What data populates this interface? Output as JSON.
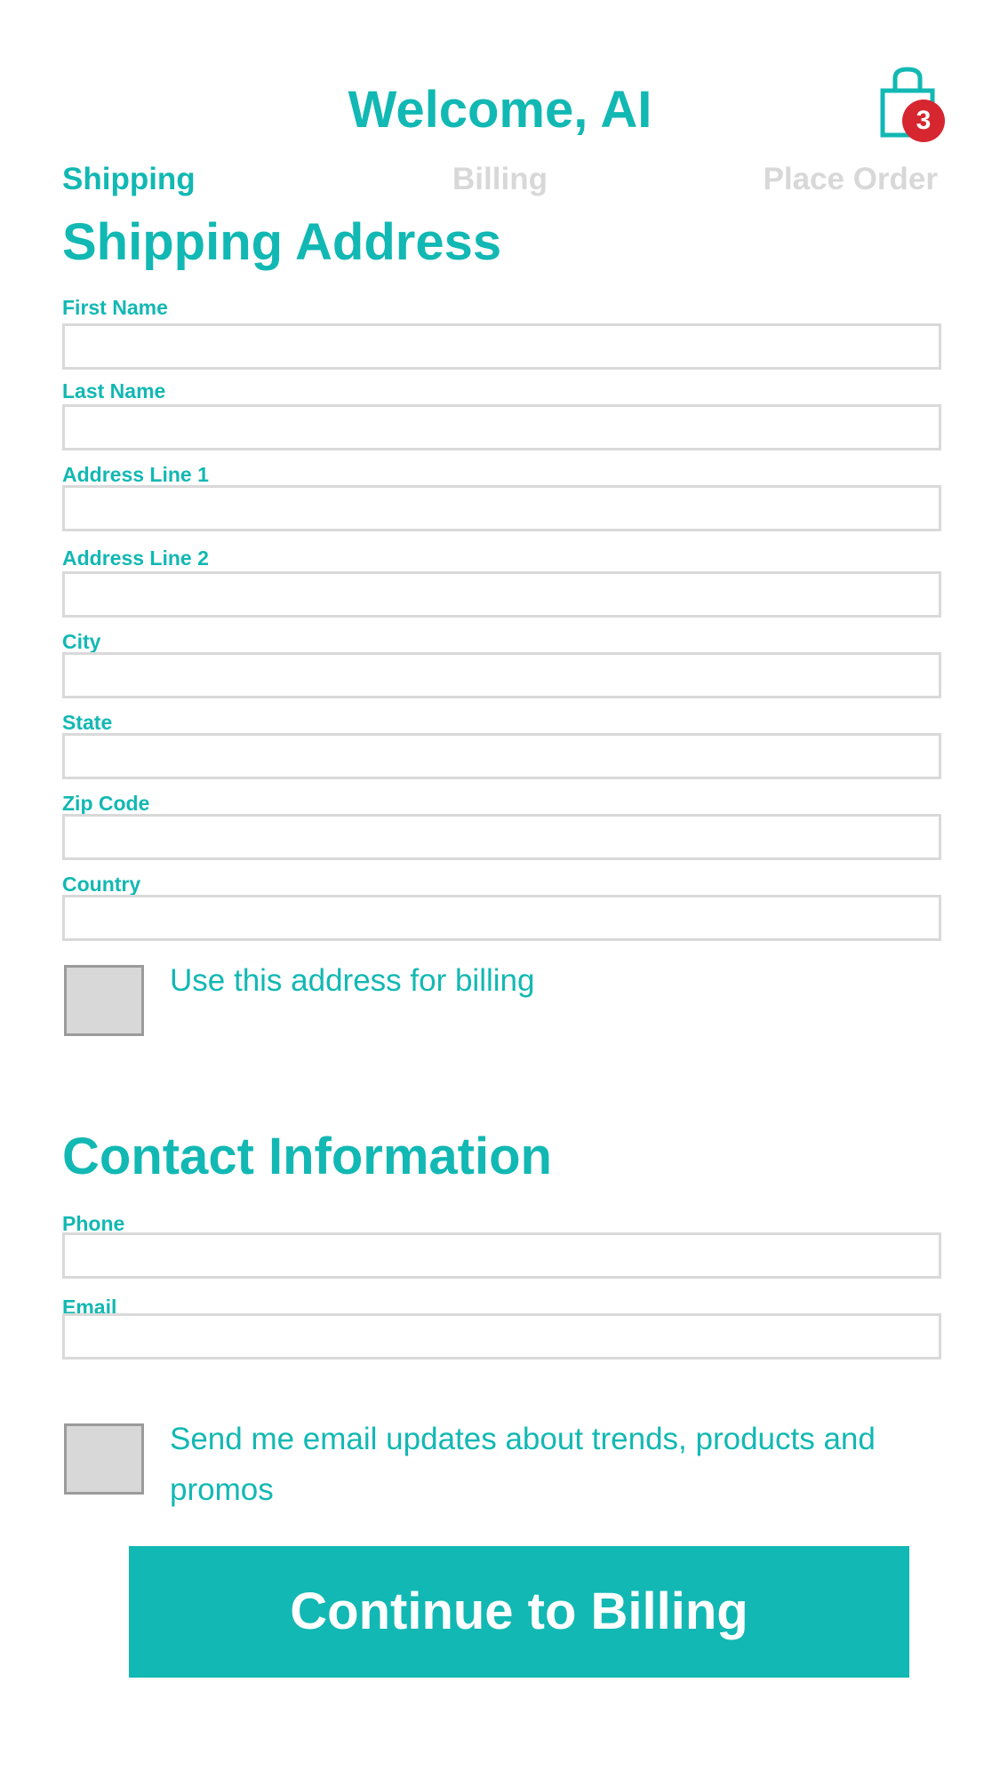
{
  "header": {
    "title": "Welcome, AI",
    "cart_count": "3"
  },
  "steps": [
    {
      "label": "Shipping",
      "state": "active"
    },
    {
      "label": "Billing",
      "state": "inactive"
    },
    {
      "label": "Place Order",
      "state": "inactive"
    }
  ],
  "shipping": {
    "title": "Shipping Address",
    "fields": [
      {
        "label": "First Name",
        "value": ""
      },
      {
        "label": "Last Name",
        "value": ""
      },
      {
        "label": "Address Line 1",
        "value": ""
      },
      {
        "label": "Address Line 2",
        "value": ""
      },
      {
        "label": "City",
        "value": ""
      },
      {
        "label": "State",
        "value": ""
      },
      {
        "label": "Zip Code",
        "value": ""
      },
      {
        "label": "Country",
        "value": ""
      }
    ],
    "billing_checkbox": {
      "label": "Use this address for billing",
      "checked": false
    }
  },
  "contact": {
    "title": "Contact Information",
    "fields": [
      {
        "label": "Phone",
        "value": ""
      },
      {
        "label": "Email",
        "value": ""
      }
    ],
    "updates_checkbox": {
      "label": "Send me email updates about trends, products and promos",
      "checked": false
    }
  },
  "actions": {
    "continue_label": "Continue to Billing"
  },
  "colors": {
    "accent": "#12b8b3",
    "inactive": "#d8d8d8",
    "badge": "#d62630",
    "input_border": "#d9d9d9",
    "checkbox_fill": "#d8d8d8"
  },
  "icons": {
    "cart": "shopping-bag-icon"
  }
}
